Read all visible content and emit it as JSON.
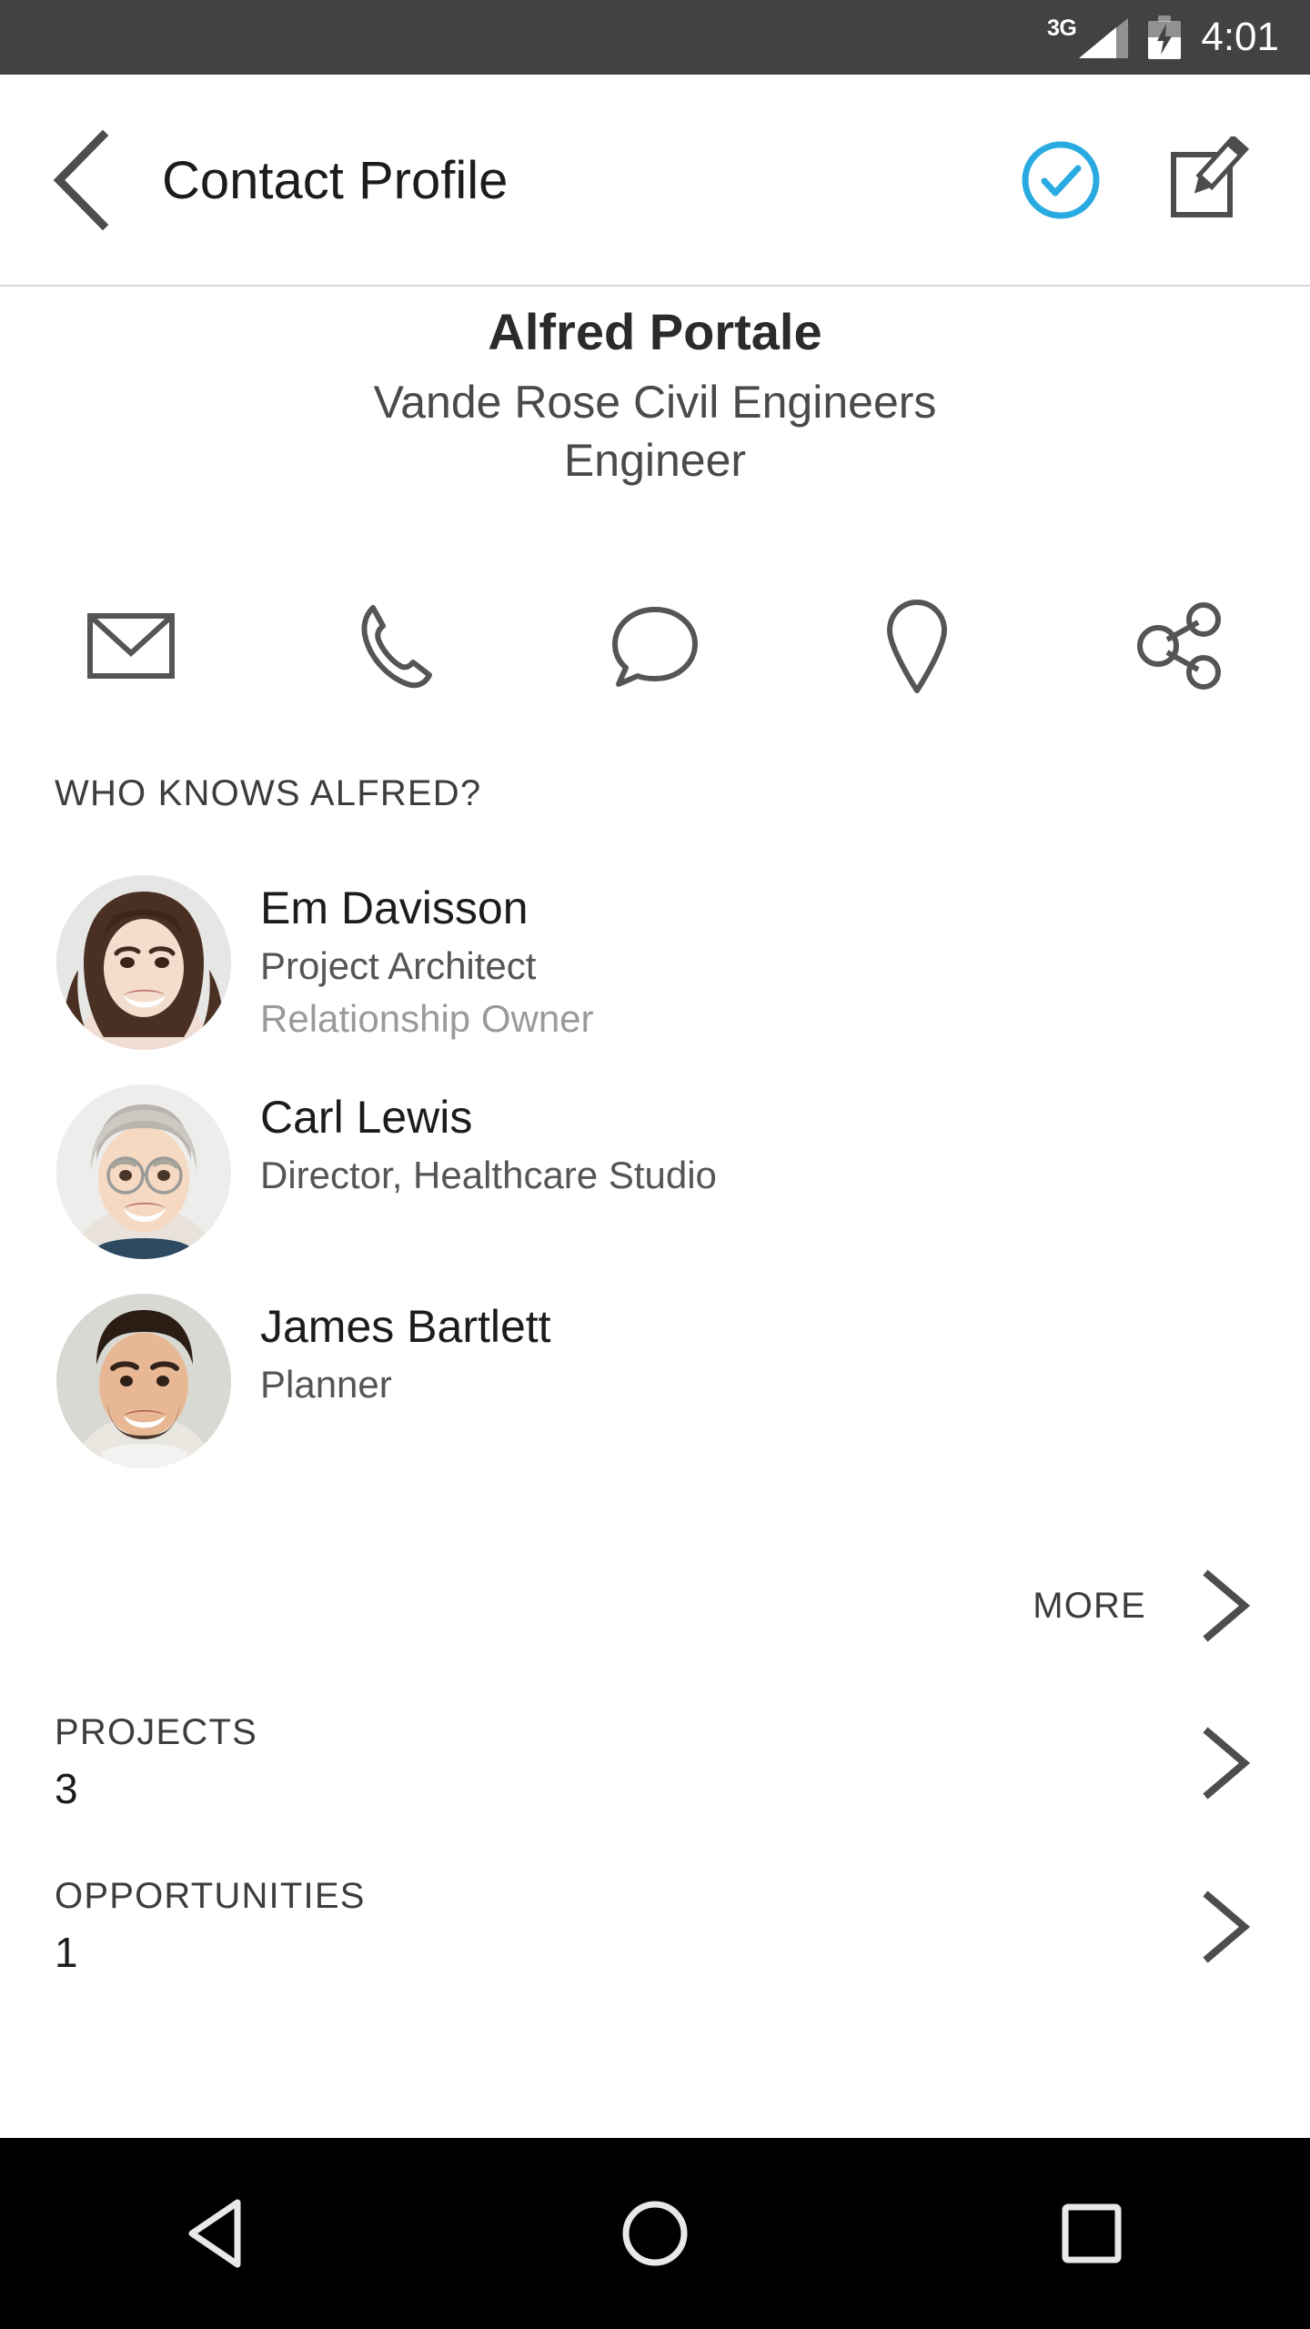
{
  "status_bar": {
    "network_label": "3G",
    "signal_icon": "signal-bars-icon",
    "battery_icon": "battery-charging-icon",
    "time": "4:01"
  },
  "app_bar": {
    "back_icon": "back-chevron-icon",
    "title": "Contact Profile",
    "actions": [
      {
        "icon": "check-circle-icon",
        "name": "confirm-button",
        "color": "#29ABE2"
      },
      {
        "icon": "edit-compose-icon",
        "name": "edit-button",
        "color": "#4d4d4d"
      }
    ]
  },
  "identity": {
    "name": "Alfred Portale",
    "company": "Vande Rose Civil Engineers",
    "role": "Engineer"
  },
  "quick_actions": [
    {
      "icon": "email-icon",
      "name": "email-action"
    },
    {
      "icon": "phone-icon",
      "name": "call-action"
    },
    {
      "icon": "message-bubble-icon",
      "name": "message-action"
    },
    {
      "icon": "location-pin-icon",
      "name": "location-action"
    },
    {
      "icon": "share-icon",
      "name": "share-action"
    }
  ],
  "who_knows": {
    "header": "WHO KNOWS ALFRED?",
    "people": [
      {
        "name": "Em Davisson",
        "title": "Project Architect",
        "note": "Relationship Owner",
        "avatar": "avatar-em-davisson"
      },
      {
        "name": "Carl Lewis",
        "title": "Director, Healthcare Studio",
        "note": "",
        "avatar": "avatar-carl-lewis"
      },
      {
        "name": "James Bartlett",
        "title": "Planner",
        "note": "",
        "avatar": "avatar-james-bartlett"
      }
    ],
    "more_label": "MORE",
    "more_icon": "chevron-right-icon"
  },
  "stats": [
    {
      "label": "PROJECTS",
      "value": "3",
      "icon": "chevron-right-icon"
    },
    {
      "label": "OPPORTUNITIES",
      "value": "1",
      "icon": "chevron-right-icon"
    }
  ],
  "nav_bar": [
    {
      "icon": "android-back-icon",
      "name": "nav-back-button"
    },
    {
      "icon": "android-home-icon",
      "name": "nav-home-button"
    },
    {
      "icon": "android-recents-icon",
      "name": "nav-recents-button"
    }
  ],
  "colors": {
    "status_bar_bg": "#424242",
    "accent_blue": "#29ABE2",
    "icon_gray": "#555555",
    "nav_bg": "#000000",
    "divider": "#dadada"
  }
}
